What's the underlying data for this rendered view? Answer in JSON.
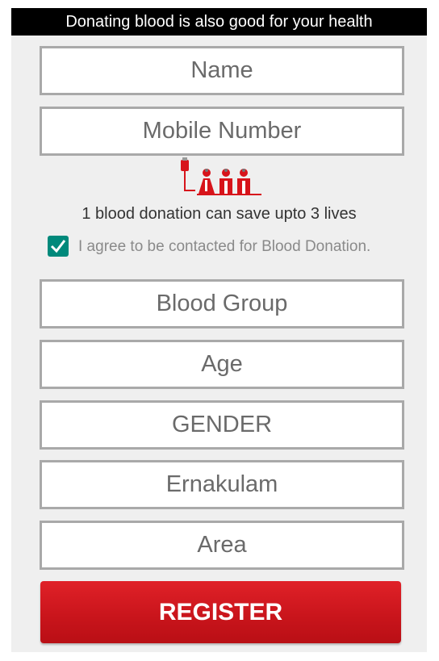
{
  "banner": {
    "text": "Donating blood is also good for your health"
  },
  "form": {
    "name_placeholder": "Name",
    "mobile_placeholder": "Mobile Number",
    "blood_group_label": "Blood Group",
    "age_placeholder": "Age",
    "gender_label": "GENDER",
    "district_label": "Ernakulam",
    "area_label": "Area"
  },
  "info": {
    "graphic_icon": "blood-donation-icon",
    "tagline": "1 blood donation can save upto 3 lives"
  },
  "consent": {
    "checked": true,
    "label": "I agree to be contacted for Blood Donation."
  },
  "actions": {
    "register_label": "REGISTER"
  },
  "colors": {
    "banner_bg": "#000000",
    "checkbox": "#00897b",
    "register_button": "#d01a20",
    "field_border": "#a9a9a9"
  }
}
